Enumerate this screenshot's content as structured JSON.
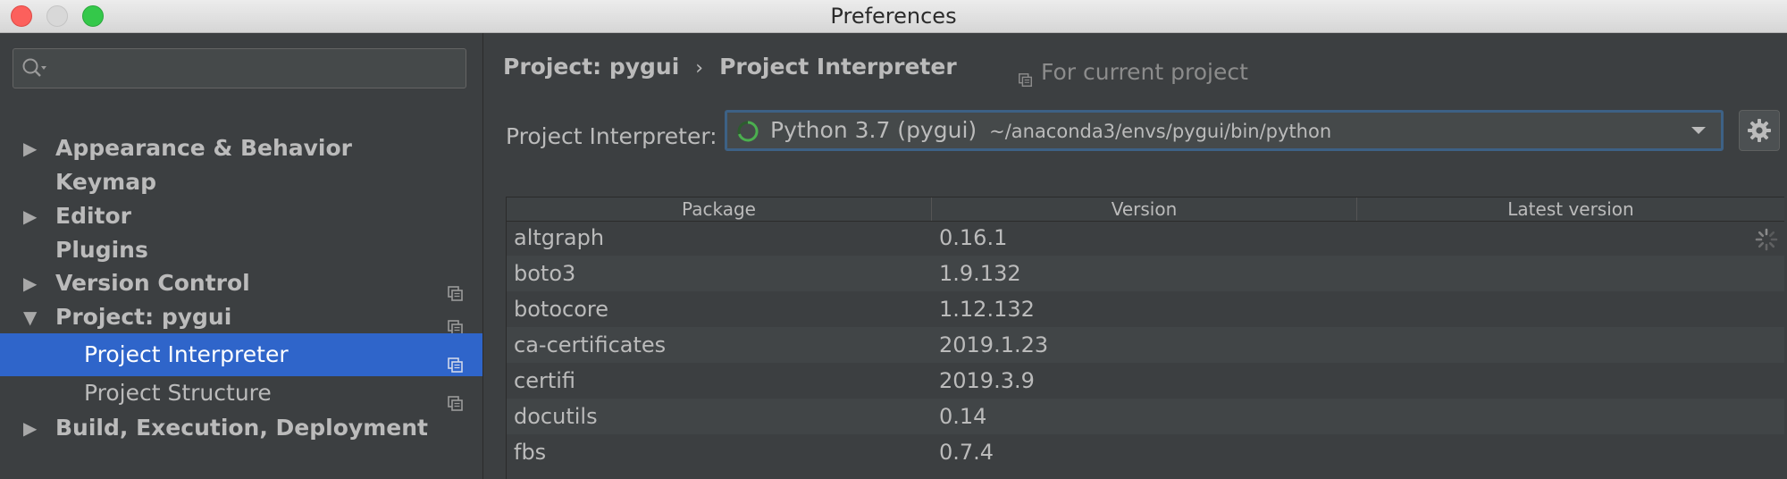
{
  "window": {
    "title": "Preferences"
  },
  "sidebar": {
    "search": {
      "value": "",
      "placeholder": ""
    },
    "items": [
      {
        "label": "Appearance & Behavior",
        "expandable": true,
        "expanded": false,
        "project_scoped": false
      },
      {
        "label": "Keymap",
        "expandable": false,
        "project_scoped": false
      },
      {
        "label": "Editor",
        "expandable": true,
        "expanded": false,
        "project_scoped": false
      },
      {
        "label": "Plugins",
        "expandable": false,
        "project_scoped": false
      },
      {
        "label": "Version Control",
        "expandable": true,
        "expanded": false,
        "project_scoped": true
      },
      {
        "label": "Project: pygui",
        "expandable": true,
        "expanded": true,
        "project_scoped": true
      },
      {
        "label": "Project Interpreter",
        "child": true,
        "selected": true,
        "project_scoped": true
      },
      {
        "label": "Project Structure",
        "child": true,
        "selected": false,
        "project_scoped": true
      },
      {
        "label": "Build, Execution, Deployment",
        "expandable": true,
        "expanded": false,
        "project_scoped": false
      }
    ]
  },
  "content": {
    "breadcrumb": {
      "parent": "Project: pygui",
      "separator": "›",
      "current": "Project Interpreter"
    },
    "scope_label": "For current project",
    "interpreter": {
      "label": "Project Interpreter:",
      "name": "Python 3.7 (pygui)",
      "path": "~/anaconda3/envs/pygui/bin/python"
    },
    "table": {
      "columns": [
        "Package",
        "Version",
        "Latest version"
      ],
      "rows": [
        {
          "package": "altgraph",
          "version": "0.16.1",
          "latest": ""
        },
        {
          "package": "boto3",
          "version": "1.9.132",
          "latest": ""
        },
        {
          "package": "botocore",
          "version": "1.12.132",
          "latest": ""
        },
        {
          "package": "ca-certificates",
          "version": "2019.1.23",
          "latest": ""
        },
        {
          "package": "certifi",
          "version": "2019.3.9",
          "latest": ""
        },
        {
          "package": "docutils",
          "version": "0.14",
          "latest": ""
        },
        {
          "package": "fbs",
          "version": "0.7.4",
          "latest": ""
        }
      ]
    }
  },
  "colors": {
    "background": "#3c3f41",
    "selection": "#2f65ca",
    "text": "#bbbbbb",
    "focus_border": "#3d6185",
    "spinner": "#4caf50"
  },
  "icons": [
    "search-icon",
    "expand-arrow-icon",
    "collapse-arrow-icon",
    "copy-icon",
    "loading-spinner-icon",
    "chevron-down-icon",
    "gear-icon"
  ]
}
